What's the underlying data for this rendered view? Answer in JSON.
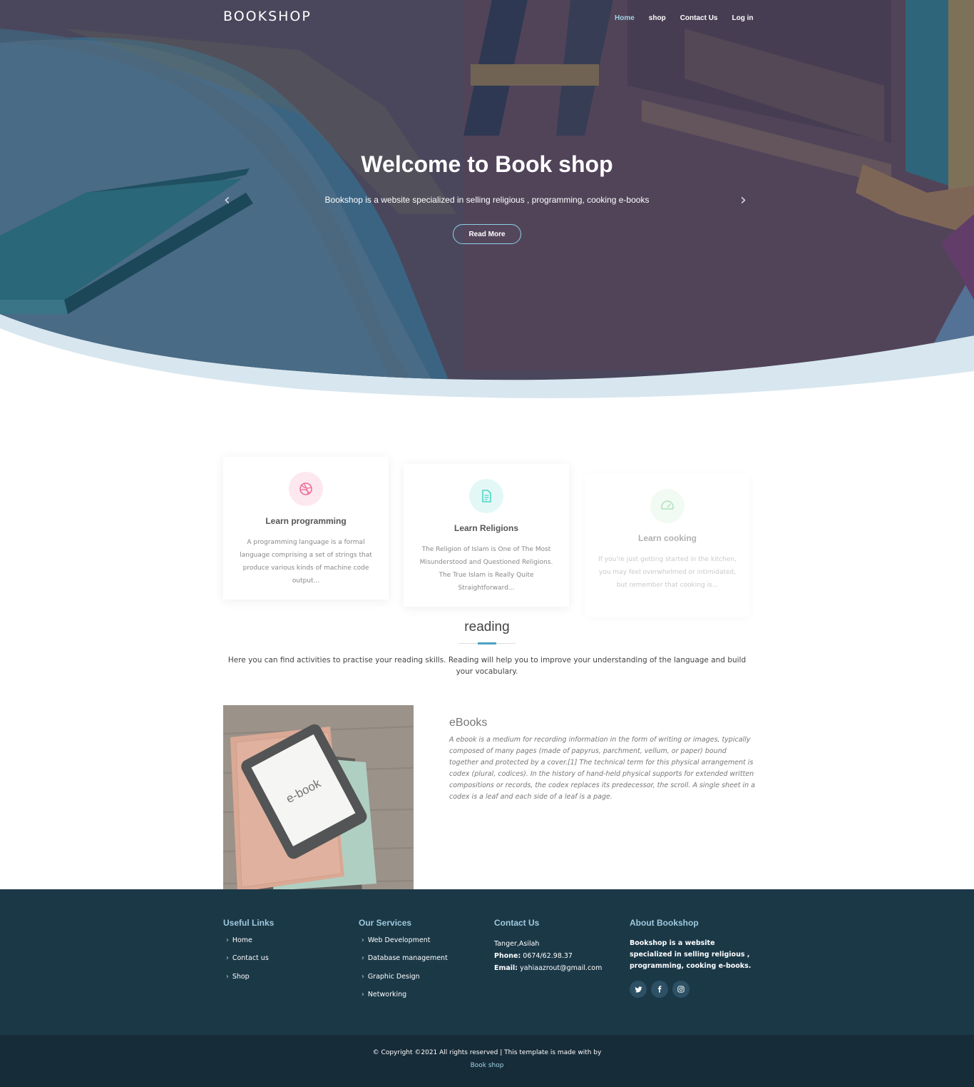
{
  "nav": {
    "brand": "BOOKSHOP",
    "links": [
      "Home",
      "shop",
      "Contact Us",
      "Log in"
    ]
  },
  "hero": {
    "title": "Welcome to Book shop",
    "subtitle": "Bookshop is a website specialized in selling religious , programming, cooking e-books",
    "button": "Read More",
    "prev": "‹",
    "next": "›"
  },
  "cards": [
    {
      "icon": "dribbble-icon",
      "color": "#f06b9a",
      "title": "Learn programming",
      "text": "A programming language is a formal language comprising a set of strings that produce various kinds of machine code output..."
    },
    {
      "icon": "document-icon",
      "color": "#4fd2c7",
      "title": "Learn Religions",
      "text": "The Religion of Islam is One of The Most Misunderstood and Questioned Religions. The True Islam is Really Quite Straightforward..."
    },
    {
      "icon": "speedometer-icon",
      "color": "#53c26b",
      "title": "Learn cooking",
      "text": "If you're just getting started in the kitchen, you may feel overwhelmed or intimidated, but remember that cooking is..."
    }
  ],
  "reading": {
    "title": "reading",
    "text": "Here you can find activities to practise your reading skills. Reading will help you to improve your understanding of the language and build your vocabulary."
  },
  "ebooks": {
    "image_label": "e-book",
    "title": "eBooks",
    "text": "A ebook is a medium for recording information in the form of writing or images, typically composed of many pages (made of papyrus, parchment, vellum, or paper) bound together and protected by a cover.[1] The technical term for this physical arrangement is codex (plural, codices). In the history of hand-held physical supports for extended written compositions or records, the codex replaces its predecessor, the scroll. A single sheet in a codex is a leaf and each side of a leaf is a page."
  },
  "footer": {
    "useful_links": {
      "title": "Useful Links",
      "items": [
        "Home",
        "Contact us",
        "Shop"
      ]
    },
    "services": {
      "title": "Our Services",
      "items": [
        "Web Development",
        "Database management",
        "Graphic Design",
        "Networking"
      ]
    },
    "contact": {
      "title": "Contact Us",
      "address": "Tanger,Asilah",
      "phone_label": "Phone:",
      "phone": "0674/62.98.37",
      "email_label": "Email:",
      "email": "yahiaazrout@gmail.com"
    },
    "about": {
      "title": "About Bookshop",
      "text": "Bookshop is a website specialized in selling religious , programming, cooking e-books."
    },
    "socials": [
      "twitter-icon",
      "facebook-icon",
      "instagram-icon"
    ]
  },
  "copyright": {
    "line1": "© Copyright ©2021 All rights reserved | This template is made with by",
    "line2": "Book shop"
  }
}
